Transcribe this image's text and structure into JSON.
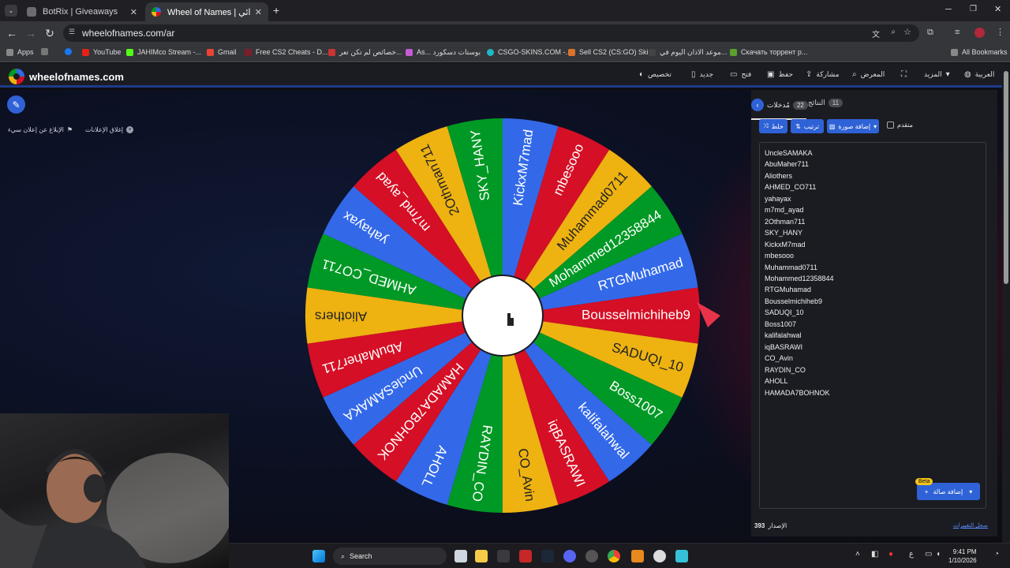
{
  "browser": {
    "tabs": [
      {
        "title": "BotRix | Giveaways",
        "active": false
      },
      {
        "title": "Wheel of Names | عجلة الاسم العشوائي",
        "active": true
      }
    ],
    "url": "wheelofnames.com/ar",
    "bookmarks": [
      "Apps",
      "YouTube",
      "JAHIMco Stream -...",
      "Gmail",
      "Free CS2 Cheats - D...",
      "خصائص لم تكن تعر...",
      "As... بوستات دسكورد",
      "CSGO-SKINS.COM -...",
      "Sell CS2 (CS:GO) Ski...",
      "موعد الاذان اليوم في...",
      "Скачать торрент р...",
      "All Bookmarks"
    ]
  },
  "site": {
    "logo": "wheelofnames.com",
    "menu": [
      "العربية",
      "المزيد",
      "",
      "المعرض",
      "مشاركة",
      "حفظ",
      "فتح",
      "جديد",
      "تخصيص"
    ],
    "report_ad": "الإبلاغ عن إعلان سيء",
    "close_ads": "إغلاق الإعلانات"
  },
  "panel": {
    "tab_entries": "مُدخلات",
    "entries_count": "22",
    "tab_results": "النتائج",
    "results_count": "11",
    "shuffle": "خلط",
    "sort": "ترتيب",
    "add_image": "إضافة صورة",
    "advanced": "متقدم",
    "add_image_bottom": "إضافة صالة",
    "beta": "Beta",
    "version_label": "الإصدار",
    "version": "393",
    "changelog": "سجل التغييرات"
  },
  "entries": [
    "UncleSAMAKA",
    "AbuMaher711",
    "Aliothers",
    "AHMED_CO711",
    "yahayax",
    "m7md_ayad",
    "2Othman711",
    "SKY_HANY",
    "KickxM7mad",
    "mbesooo",
    "Muhammad0711",
    "Mohammed12358844",
    "RTGMuhamad",
    "Bousselmichiheb9",
    "SADUQI_10",
    "Boss1007",
    "kalifalahwal",
    "iqBASRAWI",
    "CO_Avin",
    "RAYDIN_CO",
    "AHOLL",
    "HAMADA7BOHNOK"
  ],
  "wheel": {
    "colors": [
      "#3369e8",
      "#d50f25",
      "#eeb211",
      "#009925"
    ],
    "pointer_color": "#e8334a"
  },
  "taskbar": {
    "search": "Search",
    "time": "9:41 PM",
    "date": "1/10/2026",
    "lang": "ع"
  }
}
